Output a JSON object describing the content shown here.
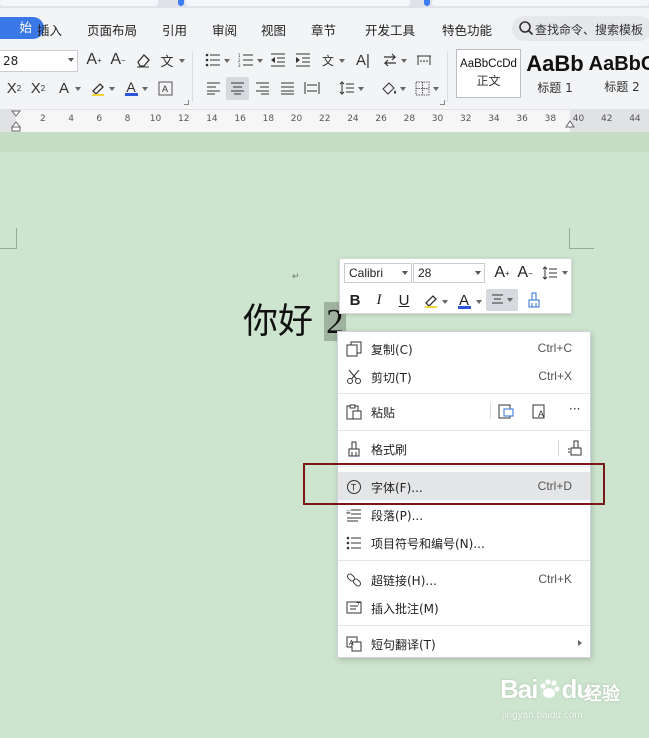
{
  "menubar": {
    "start": "始",
    "items": [
      "插入",
      "页面布局",
      "引用",
      "审阅",
      "视图",
      "章节",
      "开发工具",
      "特色功能"
    ],
    "search_placeholder": "查找命令、搜索模板"
  },
  "ribbon": {
    "font_size": "28",
    "styles": [
      {
        "sample": "AaBbCcDd",
        "name": "正文"
      },
      {
        "sample": "AaBb",
        "name": "标题 1"
      },
      {
        "sample": "AaBbC",
        "name": "标题 2"
      }
    ]
  },
  "ruler": {
    "numbers": [
      "2",
      "4",
      "6",
      "8",
      "10",
      "12",
      "14",
      "16",
      "18",
      "20",
      "22",
      "24",
      "26",
      "28",
      "30",
      "32",
      "34",
      "36",
      "38",
      "40",
      "42",
      "44"
    ]
  },
  "document": {
    "text_before": "你好 ",
    "selected_text": "2",
    "paragraph_mark": "↵"
  },
  "mini_toolbar": {
    "font_name": "Calibri",
    "font_size": "28",
    "bold": "B",
    "italic": "I",
    "underline": "U",
    "grow_font": "A",
    "shrink_font": "A",
    "font_color": "A"
  },
  "context_menu": {
    "items": [
      {
        "label": "复制(C)",
        "shortcut": "Ctrl+C",
        "icon": "copy-icon"
      },
      {
        "label": "剪切(T)",
        "shortcut": "Ctrl+X",
        "icon": "scissors-icon"
      },
      {
        "label": "粘贴",
        "shortcut": "",
        "icon": "paste-icon"
      },
      {
        "label": "格式刷",
        "shortcut": "",
        "icon": "format-painter-icon"
      },
      {
        "label": "字体(F)...",
        "shortcut": "Ctrl+D",
        "icon": "font-icon"
      },
      {
        "label": "段落(P)...",
        "shortcut": "",
        "icon": "paragraph-icon"
      },
      {
        "label": "项目符号和编号(N)...",
        "shortcut": "",
        "icon": "bullets-icon"
      },
      {
        "label": "超链接(H)...",
        "shortcut": "Ctrl+K",
        "icon": "hyperlink-icon"
      },
      {
        "label": "插入批注(M)",
        "shortcut": "",
        "icon": "comment-icon"
      },
      {
        "label": "短句翻译(T)",
        "shortcut": "",
        "icon": "translate-icon"
      }
    ],
    "more": "···"
  },
  "watermark": {
    "brand": "Bai",
    "brand2": "du",
    "cn": "经验",
    "url": "jingyan.baidu.com"
  },
  "colors": {
    "accent": "#3b78e7",
    "document_bg": "#cde5ce",
    "highlight_box": "#7a1616",
    "font_color_bar": "#2b55d6"
  }
}
